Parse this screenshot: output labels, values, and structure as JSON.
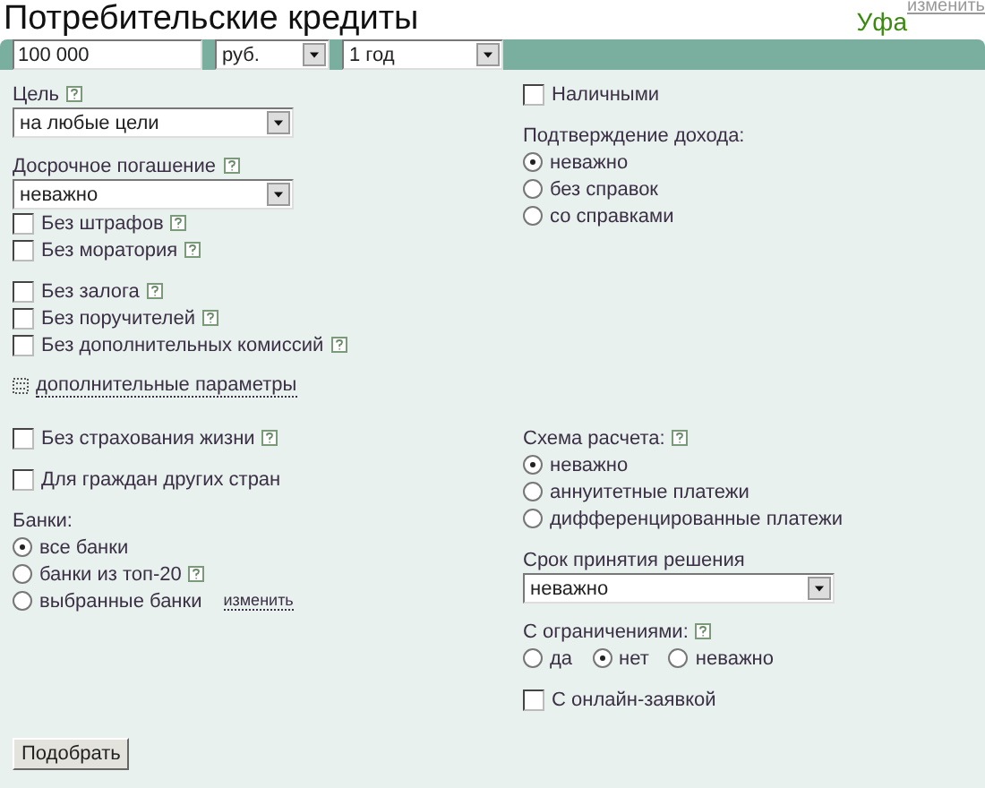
{
  "header": {
    "title": "Потребительские кредиты",
    "city": "Уфа",
    "city_link": "изменить"
  },
  "search_bar": {
    "amount": "100 000",
    "currency": "руб.",
    "term": "1 год"
  },
  "blocks": [
    {
      "left": [
        [
          {
            "kind": "select",
            "label": "Цель",
            "help": true,
            "value": "на любые цели"
          }
        ],
        [
          {
            "kind": "select",
            "label": "Досрочное погашение",
            "help": true,
            "value": "неважно"
          },
          {
            "kind": "checkbox",
            "label": "Без штрафов",
            "help": true,
            "checked": false
          },
          {
            "kind": "checkbox",
            "label": "Без моратория",
            "help": true,
            "checked": false
          }
        ],
        [
          {
            "kind": "checkbox",
            "label": "Без залога",
            "help": true,
            "checked": false
          },
          {
            "kind": "checkbox",
            "label": "Без поручителей",
            "help": true,
            "checked": false
          },
          {
            "kind": "checkbox",
            "label": "Без дополнительных комиссий",
            "help": true,
            "checked": false
          }
        ],
        [
          {
            "kind": "expander",
            "label": "дополнительные параметры"
          }
        ]
      ],
      "right": [
        [
          {
            "kind": "checkbox",
            "label": "Наличными",
            "help": false,
            "checked": false
          }
        ],
        [
          {
            "kind": "radio_group",
            "label": "Подтверждение дохода:",
            "help": false,
            "options": [
              {
                "label": "неважно",
                "selected": true
              },
              {
                "label": "без справок",
                "selected": false
              },
              {
                "label": "со справками",
                "selected": false
              }
            ]
          }
        ]
      ]
    },
    {
      "left": [
        [
          {
            "kind": "checkbox",
            "label": "Без страхования жизни",
            "help": true,
            "checked": false
          }
        ],
        [
          {
            "kind": "checkbox",
            "label": "Для граждан других стран",
            "help": false,
            "checked": false
          }
        ],
        [
          {
            "kind": "radio_group",
            "label": "Банки:",
            "help": false,
            "options": [
              {
                "label": "все банки",
                "selected": true
              },
              {
                "label": "банки из топ-20",
                "selected": false,
                "help": true
              },
              {
                "label": "выбранные банки",
                "selected": false,
                "link": "изменить"
              }
            ]
          }
        ]
      ],
      "right": [
        [
          {
            "kind": "radio_group",
            "label": "Схема расчета:",
            "help": true,
            "options": [
              {
                "label": "неважно",
                "selected": true
              },
              {
                "label": "аннуитетные платежи",
                "selected": false
              },
              {
                "label": "дифференцированные платежи",
                "selected": false
              }
            ]
          }
        ],
        [
          {
            "kind": "select",
            "label": "Срок принятия решения",
            "help": false,
            "value": "неважно"
          }
        ],
        [
          {
            "kind": "radio_row",
            "label": "С ограничениями:",
            "help": true,
            "options": [
              {
                "label": "да",
                "selected": false
              },
              {
                "label": "нет",
                "selected": true
              },
              {
                "label": "неважно",
                "selected": false
              }
            ]
          }
        ],
        [
          {
            "kind": "checkbox",
            "label": "С онлайн-заявкой",
            "help": false,
            "checked": false
          }
        ]
      ]
    }
  ],
  "submit": "Подобрать"
}
